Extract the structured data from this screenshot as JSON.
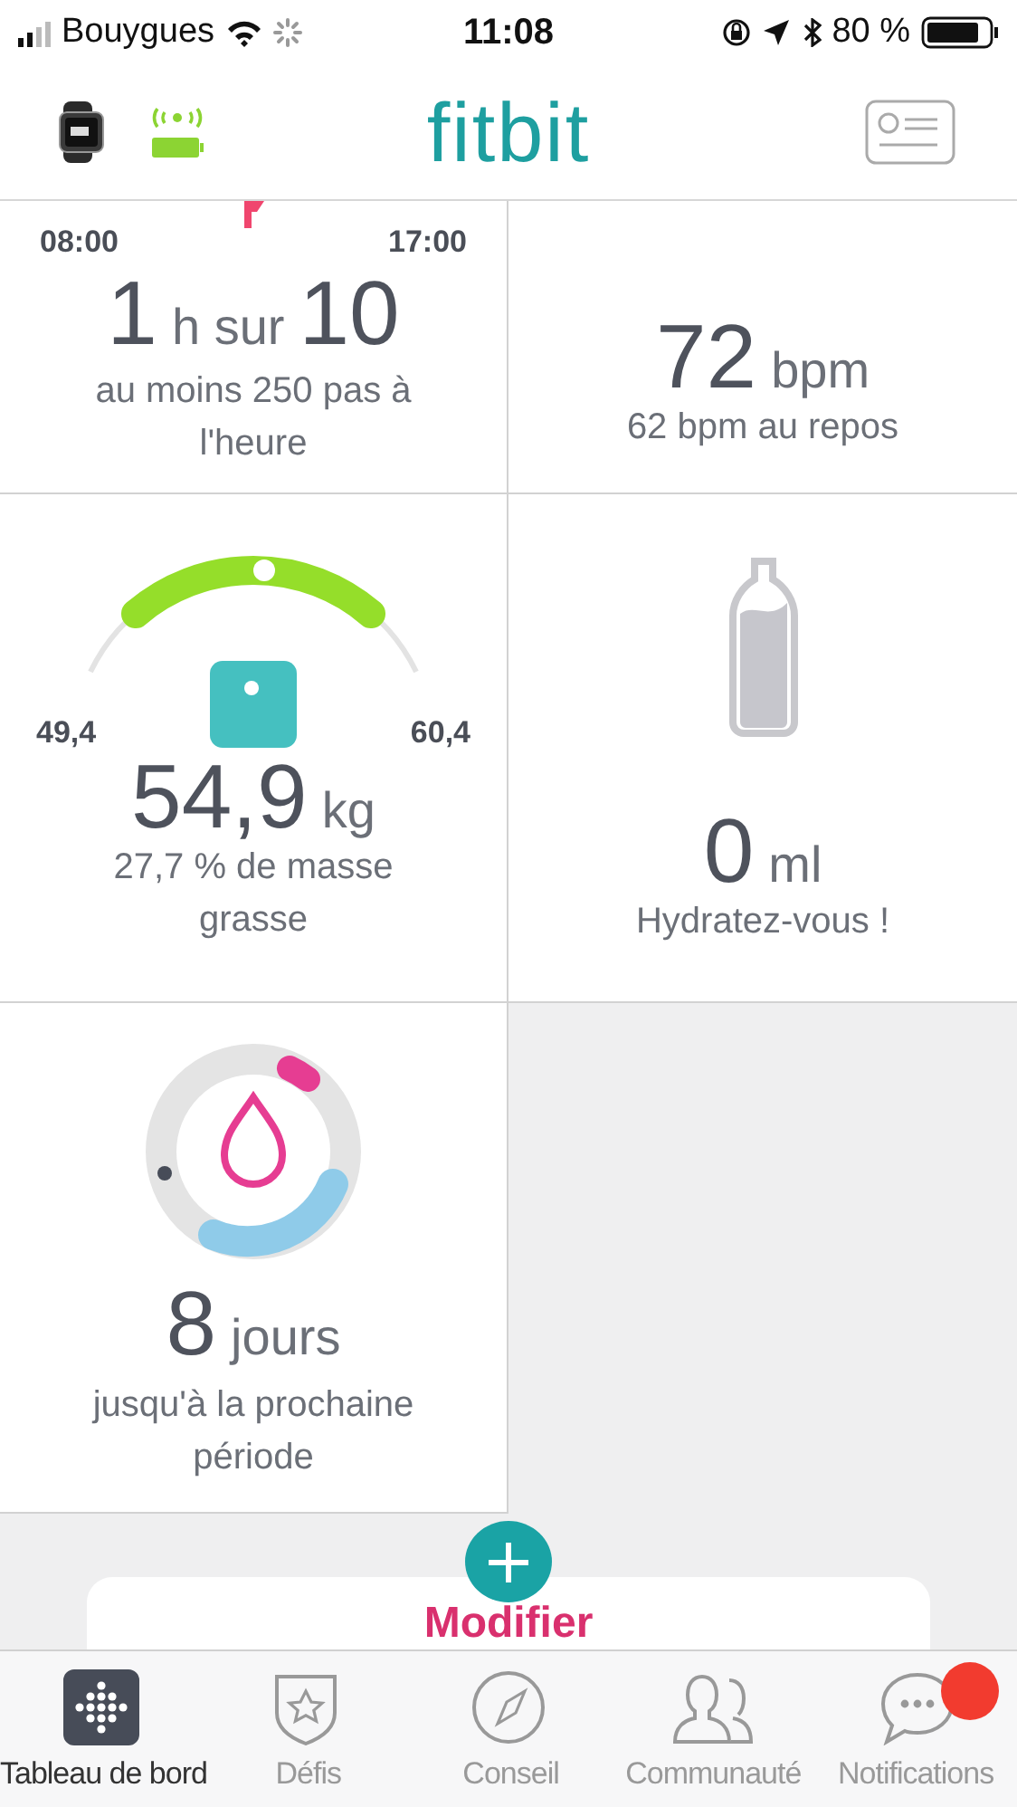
{
  "status_bar": {
    "carrier": "Bouygues",
    "time": "11:08",
    "battery": "80 %"
  },
  "header": {
    "logo": "fitbit"
  },
  "tiles": [
    {
      "kind": "hourly",
      "start": "08:00",
      "end": "17:00",
      "value": "1",
      "unit": "h sur",
      "goal": "10",
      "caption": "au moins 250 pas à l'heure"
    },
    {
      "kind": "heart",
      "value": "72",
      "unit": "bpm",
      "caption": "62 bpm au repos"
    },
    {
      "kind": "weight",
      "min": "49,4",
      "max": "60,4",
      "value": "54,9",
      "unit": "kg",
      "caption": "27,7 % de masse grasse"
    },
    {
      "kind": "water",
      "value": "0",
      "unit": "ml",
      "caption": "Hydratez-vous !"
    },
    {
      "kind": "cycle",
      "value": "8",
      "unit": "jours",
      "caption": "jusqu'à la prochaine période"
    }
  ],
  "edit_card": {
    "label": "Modifier"
  },
  "tabs": [
    {
      "label": "Tableau de bord",
      "selected": true,
      "badge": false
    },
    {
      "label": "Défis",
      "selected": false,
      "badge": false
    },
    {
      "label": "Conseil",
      "selected": false,
      "badge": false
    },
    {
      "label": "Communauté",
      "selected": false,
      "badge": false
    },
    {
      "label": "Notifications",
      "selected": false,
      "badge": true
    }
  ]
}
